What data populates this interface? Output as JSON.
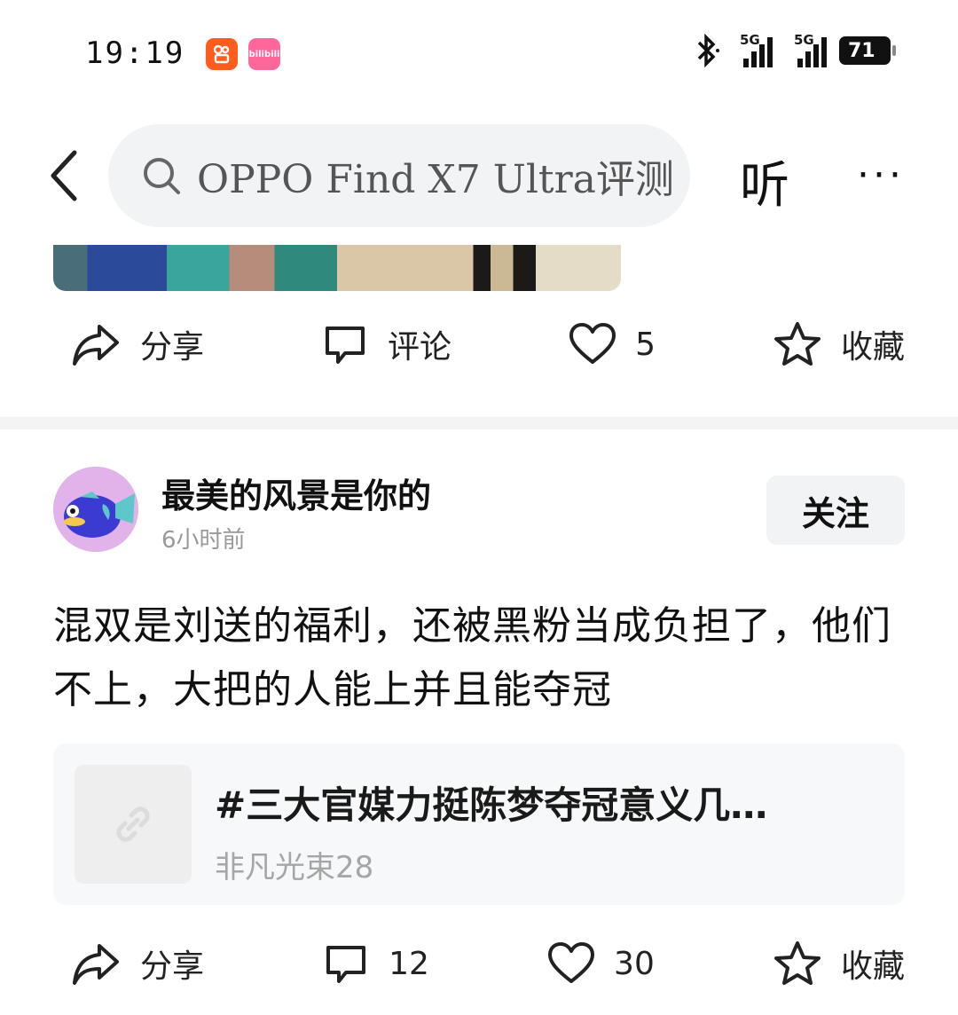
{
  "status_bar": {
    "time": "19:19",
    "apps": [
      "kuaishou-icon",
      "bilibili-icon"
    ],
    "bilibili_label": "bilibili",
    "network_1": "5G",
    "network_2": "5G",
    "battery": "71"
  },
  "top_nav": {
    "search_text": "OPPO Find X7 Ultra评测",
    "listen_label": "听",
    "more_label": "···"
  },
  "prev_post_actions": {
    "share": "分享",
    "comment": "评论",
    "like_count": "5",
    "favorite": "收藏"
  },
  "post": {
    "username": "最美的风景是你的",
    "time": "6小时前",
    "follow_label": "关注",
    "content": "混双是刘送的福利，还被黑粉当成负担了，他们不上，大把的人能上并且能夺冠",
    "link": {
      "title": "#三大官媒力挺陈梦夺冠意义几…",
      "source": "非凡光束28"
    }
  },
  "post_actions": {
    "share": "分享",
    "comment_count": "12",
    "like_count": "30",
    "favorite": "收藏"
  },
  "colors": {
    "background": "#ffffff",
    "search_bg": "#f2f3f5",
    "divider": "#f4f4f4",
    "muted_text": "#999999"
  }
}
